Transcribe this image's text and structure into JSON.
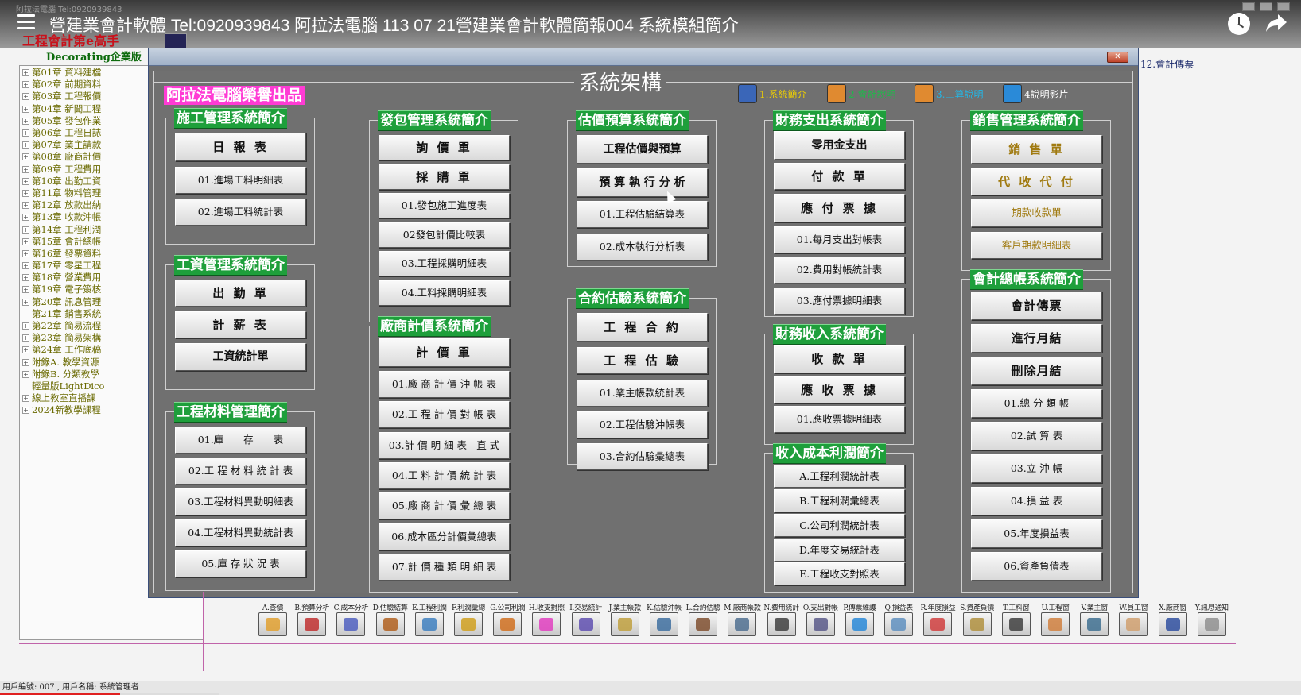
{
  "video": {
    "title": "營建業會計軟體 Tel:0920939843 阿拉法電腦 113 07 21營建業會計軟體簡報004 系統模組簡介",
    "app_title_faded": "阿拉法電腦 Tel:0920939843"
  },
  "brand": {
    "line1": "工程會計第e高手",
    "line2": "Decorating企業版"
  },
  "tree": [
    {
      "label": "第01章 資料建檔",
      "expandable": true
    },
    {
      "label": "第02章 前期資料",
      "expandable": true
    },
    {
      "label": "第03章 工程報價",
      "expandable": true
    },
    {
      "label": "第04章 新聞工程",
      "expandable": true
    },
    {
      "label": "第05章 發包作業",
      "expandable": true
    },
    {
      "label": "第06章 工程日誌",
      "expandable": true
    },
    {
      "label": "第07章 業主請款",
      "expandable": true
    },
    {
      "label": "第08章 廠商計價",
      "expandable": true
    },
    {
      "label": "第09章 工程費用",
      "expandable": true
    },
    {
      "label": "第10章 出勤工資",
      "expandable": true
    },
    {
      "label": "第11章 物料管理",
      "expandable": true
    },
    {
      "label": "第12章 放款出納",
      "expandable": true
    },
    {
      "label": "第13章 收款沖帳",
      "expandable": true
    },
    {
      "label": "第14章 工程利潤",
      "expandable": true
    },
    {
      "label": "第15章 會計總帳",
      "expandable": true
    },
    {
      "label": "第16章 發票資料",
      "expandable": true
    },
    {
      "label": "第17章 零星工程",
      "expandable": true
    },
    {
      "label": "第18章 營業費用",
      "expandable": true
    },
    {
      "label": "第19章 電子簽核",
      "expandable": true
    },
    {
      "label": "第20章 訊息管理",
      "expandable": true
    },
    {
      "label": "第21章 銷售系統",
      "expandable": false
    },
    {
      "label": "第22章 簡易流程",
      "expandable": true
    },
    {
      "label": "第23章 簡易架構",
      "expandable": true
    },
    {
      "label": "第24章 工作底稿",
      "expandable": true
    },
    {
      "label": "附錄A. 教學資源",
      "expandable": true
    },
    {
      "label": "附錄B. 分類教學",
      "expandable": true
    },
    {
      "label": "輕量版LightDico",
      "expandable": false
    },
    {
      "label": "線上教室直播課",
      "expandable": true
    },
    {
      "label": "2024新教學課程",
      "expandable": true
    }
  ],
  "right_label": "12.會計傳票",
  "dialog": {
    "close_label": "✕",
    "heading": "系統架構",
    "producer": "阿拉法電腦榮譽出品",
    "links": [
      {
        "label": "1.系統簡介",
        "color": "#f0d000",
        "icon_color": "#3a66b8"
      },
      {
        "label": "2.會計說明",
        "color": "#1fb84a",
        "icon_color": "#e08a30"
      },
      {
        "label": "3.工算說明",
        "color": "#22b8e8",
        "icon_color": "#e08a30"
      },
      {
        "label": "4說明影片",
        "color": "#ffffff",
        "icon_color": "#2a8ad8"
      }
    ]
  },
  "groups": {
    "construction": {
      "title": "施工管理系統簡介",
      "buttons": [
        "日 報 表",
        "01.進場工料明細表",
        "02.進場工料統計表"
      ]
    },
    "wages": {
      "title": "工資管理系統簡介",
      "buttons": [
        "出 勤 單",
        "計 薪 表",
        "工資統計單"
      ]
    },
    "materials": {
      "title": "工程材料管理簡介",
      "buttons": [
        "01.庫　　存　　表",
        "02.工 程 材 料 統 計 表",
        "03.工程材料異動明細表",
        "04.工程材料異動統計表",
        "05.庫 存 狀 況 表"
      ]
    },
    "subcontract": {
      "title": "發包管理系統簡介",
      "buttons": [
        "詢 價 單",
        "採 購 單",
        "01.發包施工進度表",
        "02發包計價比較表",
        "03.工程採購明細表",
        "04.工料採購明細表"
      ]
    },
    "vendor": {
      "title": "廠商計價系統簡介",
      "buttons": [
        "計 價 單",
        "01.廠 商 計 價 沖 帳 表",
        "02.工 程 計 價 對 帳 表",
        "03.計 價 明 細 表 - 直 式",
        "04.工 料 計 價 統 計 表",
        "05.廠 商 計 價 彙 總 表",
        "06.成本區分計價彙總表",
        "07.計 價 種 類 明 細 表"
      ]
    },
    "estimate": {
      "title": "估價預算系統簡介",
      "buttons": [
        "工程估價與預算",
        "預 算 執 行 分 析",
        "01.工程估驗結算表",
        "02.成本執行分析表"
      ]
    },
    "contract": {
      "title": "合約估驗系統簡介",
      "buttons": [
        "工 程 合 約",
        "工 程 估 驗",
        "01.業主帳款統計表",
        "02.工程估驗沖帳表",
        "03.合約估驗彙總表"
      ]
    },
    "expense": {
      "title": "財務支出系統簡介",
      "buttons": [
        "零用金支出",
        "付 款 單",
        "應 付 票 據",
        "01.每月支出對帳表",
        "02.費用對帳統計表",
        "03.應付票據明細表"
      ]
    },
    "income": {
      "title": "財務收入系統簡介",
      "buttons": [
        "收 款 單",
        "應 收 票 據",
        "01.應收票據明細表"
      ]
    },
    "profit": {
      "title": "收入成本利潤簡介",
      "buttons": [
        "A.工程利潤統計表",
        "B.工程利潤彙總表",
        "C.公司利潤統計表",
        "D.年度交易統計表",
        "E.工程收支對照表"
      ]
    },
    "sales": {
      "title": "銷售管理系統簡介",
      "buttons": [
        "銷 售 單",
        "代 收 代 付",
        "期款收款單",
        "客戶期款明細表"
      ]
    },
    "ledger": {
      "title": "會計總帳系統簡介",
      "buttons": [
        "會計傳票",
        "進行月結",
        "刪除月結",
        "01.總 分 類 帳",
        "02.試 算 表",
        "03.立 沖 帳",
        "04.損 益 表",
        "05.年度損益表",
        "06.資產負債表"
      ]
    }
  },
  "toolbar": [
    {
      "label": "A.查價",
      "icon": "paint-icon",
      "color": "#e0a030"
    },
    {
      "label": "B.預算分析",
      "icon": "tools-icon",
      "color": "#c03030"
    },
    {
      "label": "C.成本分析",
      "icon": "pen-icon",
      "color": "#5060c0"
    },
    {
      "label": "D.估驗結算",
      "icon": "pencil-icon",
      "color": "#b06020"
    },
    {
      "label": "E.工程利潤",
      "icon": "calendar-icon",
      "color": "#4080c0"
    },
    {
      "label": "F.利潤彙總",
      "icon": "folder-icon",
      "color": "#d0a020"
    },
    {
      "label": "G.公司利潤",
      "icon": "house-icon",
      "color": "#d07020"
    },
    {
      "label": "H.收支對照",
      "icon": "brush-icon",
      "color": "#e040c0"
    },
    {
      "label": "I.交易統計",
      "icon": "stats-icon",
      "color": "#6050b0"
    },
    {
      "label": "J.業主帳款",
      "icon": "notebook-icon",
      "color": "#c0a040"
    },
    {
      "label": "K.估驗沖帳",
      "icon": "copy-icon",
      "color": "#4070a0"
    },
    {
      "label": "L.合約估驗",
      "icon": "book-icon",
      "color": "#805030"
    },
    {
      "label": "M.廠商帳款",
      "icon": "scanner-icon",
      "color": "#507090"
    },
    {
      "label": "N.費用統計",
      "icon": "compass-icon",
      "color": "#404040"
    },
    {
      "label": "O.支出對帳",
      "icon": "screen-icon",
      "color": "#5a5a8a"
    },
    {
      "label": "P.傳票維護",
      "icon": "cube-icon",
      "color": "#2a8ad8"
    },
    {
      "label": "Q.損益表",
      "icon": "chart-icon",
      "color": "#6090c0"
    },
    {
      "label": "R.年度損益",
      "icon": "bar-chart-icon",
      "color": "#d04040"
    },
    {
      "label": "S.資產負債",
      "icon": "sign-icon",
      "color": "#b09040"
    },
    {
      "label": "T.工料窗",
      "icon": "tool-window-icon",
      "color": "#404040"
    },
    {
      "label": "U.工程窗",
      "icon": "building-icon",
      "color": "#d08040"
    },
    {
      "label": "V.業主窗",
      "icon": "computer-user-icon",
      "color": "#407090"
    },
    {
      "label": "W.員工窗",
      "icon": "face-icon",
      "color": "#d0a070"
    },
    {
      "label": "X.廠商窗",
      "icon": "worker-icon",
      "color": "#3050a0"
    },
    {
      "label": "Y.訊息通知",
      "icon": "cup-icon",
      "color": "#909090"
    }
  ],
  "status_bar": "用戶編號: 007 , 用戶名稱: 系統管理者",
  "status_progress": 0.55
}
